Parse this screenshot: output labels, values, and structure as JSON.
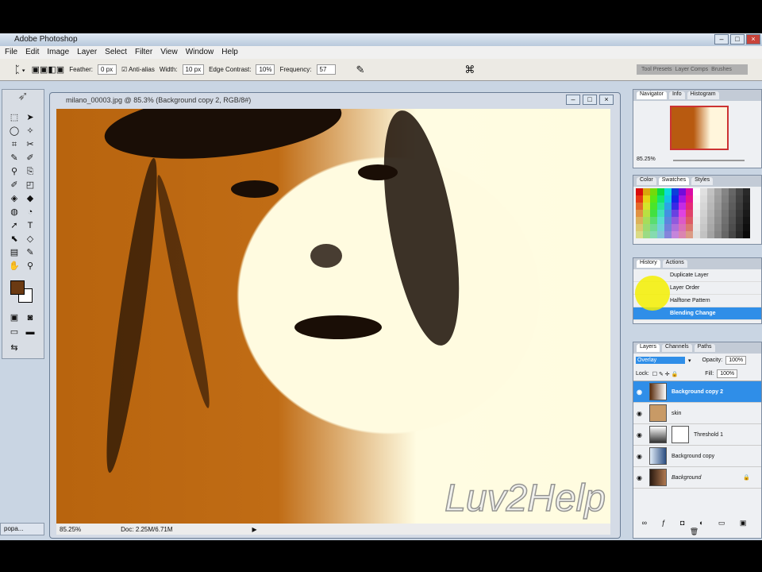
{
  "app_title": "Adobe Photoshop",
  "menu": [
    "File",
    "Edit",
    "Image",
    "Layer",
    "Select",
    "Filter",
    "View",
    "Window",
    "Help"
  ],
  "options": {
    "feather_label": "Feather:",
    "feather": "0 px",
    "antialias": "Anti-alias",
    "width_label": "Width:",
    "width": "10 px",
    "edge_label": "Edge Contrast:",
    "edge": "10%",
    "freq_label": "Frequency:",
    "freq": "57"
  },
  "palette_well": [
    "Tool Presets",
    "Layer Comps",
    "Brushes"
  ],
  "document": {
    "title": "milano_00003.jpg @ 85.3% (Background copy 2, RGB/8#)",
    "zoom": "85.25%",
    "doc_size": "Doc: 2.25M/6.71M"
  },
  "navigator": {
    "tabs": [
      "Navigator",
      "Info",
      "Histogram"
    ],
    "zoom": "85.25%"
  },
  "swatches": {
    "tabs": [
      "Color",
      "Swatches",
      "Styles"
    ]
  },
  "history": {
    "tabs": [
      "History",
      "Actions"
    ],
    "items": [
      "Duplicate Layer",
      "Layer Order",
      "Halftone Pattern",
      "Blending Change"
    ]
  },
  "layers": {
    "tabs": [
      "Layers",
      "Channels",
      "Paths"
    ],
    "blend_mode": "Overlay",
    "opacity_label": "Opacity:",
    "opacity": "100%",
    "lock_label": "Lock:",
    "fill_label": "Fill:",
    "fill": "100%",
    "items": [
      {
        "name": "Background copy 2",
        "selected": true
      },
      {
        "name": "skin"
      },
      {
        "name": "Threshold 1"
      },
      {
        "name": "Background copy"
      },
      {
        "name": "Background",
        "locked": true
      }
    ]
  },
  "taskbar_item": "popa...",
  "watermark": "Luv2Help",
  "colors": {
    "foreground": "#6b3a12",
    "highlight": "#2f8ee8"
  }
}
